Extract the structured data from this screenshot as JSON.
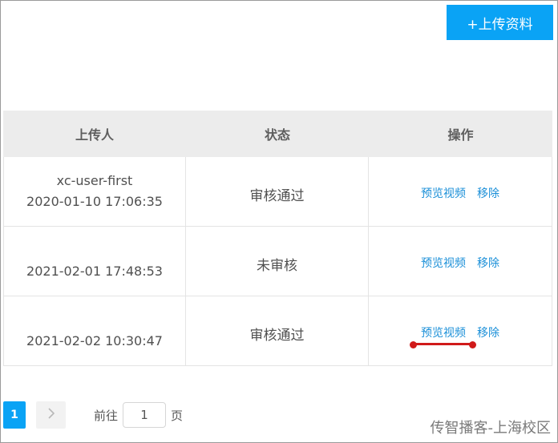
{
  "toolbar": {
    "upload_label": "+上传资料"
  },
  "table": {
    "columns": [
      "上传人",
      "状态",
      "操作"
    ],
    "rows": [
      {
        "uploader": "xc-user-first",
        "time": "2020-01-10 17:06:35",
        "status": "审核通过",
        "preview_label": "预览视频",
        "remove_label": "移除"
      },
      {
        "uploader": "",
        "time": "2021-02-01 17:48:53",
        "status": "未审核",
        "preview_label": "预览视频",
        "remove_label": "移除"
      },
      {
        "uploader": "",
        "time": "2021-02-02 10:30:47",
        "status": "审核通过",
        "preview_label": "预览视频",
        "remove_label": "移除"
      }
    ]
  },
  "pagination": {
    "current_page": "1",
    "next_icon": "chevron-right-icon",
    "goto_label": "前往",
    "goto_value": "1",
    "page_suffix": "页"
  },
  "watermark": "传智播客-上海校区",
  "colors": {
    "accent": "#0aa3f5",
    "link": "#1a8fd8",
    "annotation": "#d01a1a",
    "header_bg": "#ececec"
  }
}
